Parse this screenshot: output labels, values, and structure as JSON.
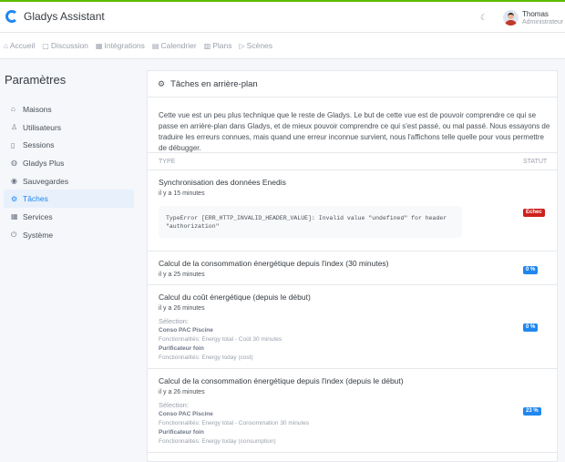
{
  "app": {
    "title": "Gladys Assistant"
  },
  "user": {
    "name": "Thomas",
    "role": "Administrateur"
  },
  "nav": [
    {
      "label": "Accueil",
      "icon": "home-icon",
      "glyph": "⌂"
    },
    {
      "label": "Discussion",
      "icon": "chat-icon",
      "glyph": "▢"
    },
    {
      "label": "Intégrations",
      "icon": "grid-icon",
      "glyph": "▦"
    },
    {
      "label": "Calendrier",
      "icon": "calendar-icon",
      "glyph": "▤"
    },
    {
      "label": "Plans",
      "icon": "map-icon",
      "glyph": "▥"
    },
    {
      "label": "Scènes",
      "icon": "play-icon",
      "glyph": "▷"
    }
  ],
  "page": {
    "title": "Paramètres"
  },
  "sidebar": [
    {
      "label": "Maisons",
      "icon": "home-icon",
      "glyph": "⌂",
      "active": false
    },
    {
      "label": "Utilisateurs",
      "icon": "user-icon",
      "glyph": "♙",
      "active": false
    },
    {
      "label": "Sessions",
      "icon": "phone-icon",
      "glyph": "▯",
      "active": false
    },
    {
      "label": "Gladys Plus",
      "icon": "globe-icon",
      "glyph": "◍",
      "active": false
    },
    {
      "label": "Sauvegardes",
      "icon": "disc-icon",
      "glyph": "◉",
      "active": false
    },
    {
      "label": "Tâches",
      "icon": "gear-icon",
      "glyph": "⚙",
      "active": true
    },
    {
      "label": "Services",
      "icon": "grid-icon",
      "glyph": "▦",
      "active": false
    },
    {
      "label": "Système",
      "icon": "power-icon",
      "glyph": "⏻",
      "active": false
    }
  ],
  "card": {
    "header_glyph": "⚙",
    "title": "Tâches en arrière-plan",
    "intro": "Cette vue est un peu plus technique que le reste de Gladys. Le but de cette vue est de pouvoir comprendre ce qui se passe en arrière-plan dans Gladys, et de mieux pouvoir comprendre ce qui s'est passé, ou mal passé. Nous essayons de traduire les erreurs connues, mais quand une erreur inconnue survient, nous l'affichons telle quelle pour vous permettre de débugger.",
    "col_type": "TYPE",
    "col_status": "STATUT"
  },
  "tasks": [
    {
      "name": "Synchronisation des données Enedis",
      "time": "il y a 15 minutes",
      "error": "TypeError [ERR_HTTP_INVALID_HEADER_VALUE]: Invalid value \"undefined\" for header \"authorization\"",
      "status": "Echec"
    },
    {
      "name": "Calcul de la consommation énergétique depuis l'index (30 minutes)",
      "time": "il y a 25 minutes",
      "status": "0 %"
    },
    {
      "name": "Calcul du coût énergétique (depuis le début)",
      "time": "il y a 26 minutes",
      "selection_label": "Sélection:",
      "selection": [
        {
          "item": "Conso PAC Piscine",
          "features": "Fonctionnalités: Energy total - Coût 30 minutes"
        },
        {
          "item": "Purificateur foin",
          "features": "Fonctionnalités: Energy today (cost)"
        }
      ],
      "status": "0 %"
    },
    {
      "name": "Calcul de la consommation énergétique depuis l'index (depuis le début)",
      "time": "il y a 26 minutes",
      "selection_label": "Sélection:",
      "selection": [
        {
          "item": "Conso PAC Piscine",
          "features": "Fonctionnalités: Energy total - Consommation 30 minutes"
        },
        {
          "item": "Purificateur foin",
          "features": "Fonctionnalités: Energy today (consumption)"
        }
      ],
      "status": "23 %"
    }
  ],
  "colors": {
    "accent": "#2087f0",
    "danger": "#cd201f",
    "top_border": "#5eba00"
  }
}
